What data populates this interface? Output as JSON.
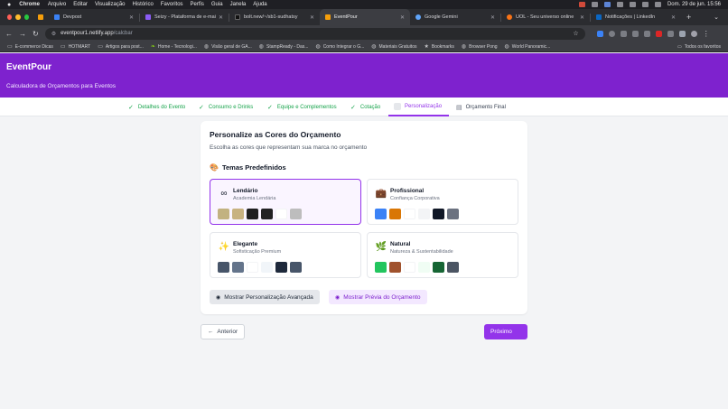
{
  "menubar": {
    "app": "Chrome",
    "items": [
      "Arquivo",
      "Editar",
      "Visualização",
      "Histórico",
      "Favoritos",
      "Perfis",
      "Guia",
      "Janela",
      "Ajuda"
    ],
    "clock": "Dom. 29 de jun.  15:56"
  },
  "tabs": [
    {
      "label": "Devpost",
      "favicon": "#3b82f6"
    },
    {
      "label": "Seizy - Plataforma de e-mail",
      "favicon": "#8b5cf6"
    },
    {
      "label": "bolt.new/~/sb1-sudhatsy",
      "favicon": "#111111"
    },
    {
      "label": "EventPour",
      "favicon": "#f59e0b"
    },
    {
      "label": "Google Gemini",
      "favicon": "#60a5fa"
    },
    {
      "label": "UOL - Seu universo online",
      "favicon": "#f97316"
    },
    {
      "label": "Notificações | LinkedIn",
      "favicon": "#0a66c2"
    }
  ],
  "address": {
    "host": "eventpour1.netlify.app",
    "path": "/calcbar"
  },
  "bookmarks": [
    {
      "label": "E-commerce Dicas",
      "icon": "folder-icon"
    },
    {
      "label": "HOTMART",
      "icon": "folder-icon"
    },
    {
      "label": "Artigos para post...",
      "icon": "folder-icon"
    },
    {
      "label": "Home - Tecnologi...",
      "icon": "leaf-icon"
    },
    {
      "label": "Visão geral de GA...",
      "icon": "globe-icon"
    },
    {
      "label": "StampReady - Das...",
      "icon": "globe-icon"
    },
    {
      "label": "Como Integrar o G...",
      "icon": "globe-icon"
    },
    {
      "label": "Materiais Gratuitos",
      "icon": "globe-icon"
    },
    {
      "label": "Bookmarks",
      "icon": "star-icon"
    },
    {
      "label": "Browser Pong",
      "icon": "globe-icon"
    },
    {
      "label": "World Panoramic...",
      "icon": "globe-icon"
    }
  ],
  "bookmarks_all": "Todos os favoritos",
  "app": {
    "brand": "EventPour",
    "subtitle": "Calculadora de Orçamentos para Eventos"
  },
  "steps": [
    {
      "label": "Detalhes do Evento",
      "state": "done"
    },
    {
      "label": "Consumo e Drinks",
      "state": "done"
    },
    {
      "label": "Equipe e Complementos",
      "state": "done"
    },
    {
      "label": "Cotação",
      "state": "done"
    },
    {
      "label": "Personalização",
      "state": "current"
    },
    {
      "label": "Orçamento Final",
      "state": "upcoming"
    }
  ],
  "card": {
    "title": "Personalize as Cores do Orçamento",
    "description": "Escolha as cores que representam sua marca no orçamento",
    "section_title": "Temas Predefinidos"
  },
  "themes": [
    {
      "name": "Lendário",
      "subtitle": "Academia Lendária",
      "icon": "∞",
      "selected": true,
      "colors": [
        "#c2b280",
        "#c8b280",
        "#1f1f1f",
        "#222222",
        "#ffffff",
        "#bdbdbd"
      ]
    },
    {
      "name": "Profissional",
      "subtitle": "Confiança Corporativa",
      "icon": "💼",
      "selected": false,
      "colors": [
        "#3b82f6",
        "#d97706",
        "#ffffff",
        "#f3f4f6",
        "#111827",
        "#6b7280"
      ]
    },
    {
      "name": "Elegante",
      "subtitle": "Sofisticação Premium",
      "icon": "✨",
      "selected": false,
      "colors": [
        "#475569",
        "#64748b",
        "#ffffff",
        "#f1f5f9",
        "#1e293b",
        "#475569"
      ]
    },
    {
      "name": "Natural",
      "subtitle": "Natureza & Sustentabilidade",
      "icon": "🌿",
      "selected": false,
      "colors": [
        "#22c55e",
        "#a0522d",
        "#ffffff",
        "#f0fdf4",
        "#166534",
        "#4b5563"
      ]
    }
  ],
  "buttons": {
    "advanced": "Mostrar Personalização Avançada",
    "preview": "Mostrar Prévia do Orçamento",
    "previous": "Anterior",
    "next": "Próximo"
  }
}
